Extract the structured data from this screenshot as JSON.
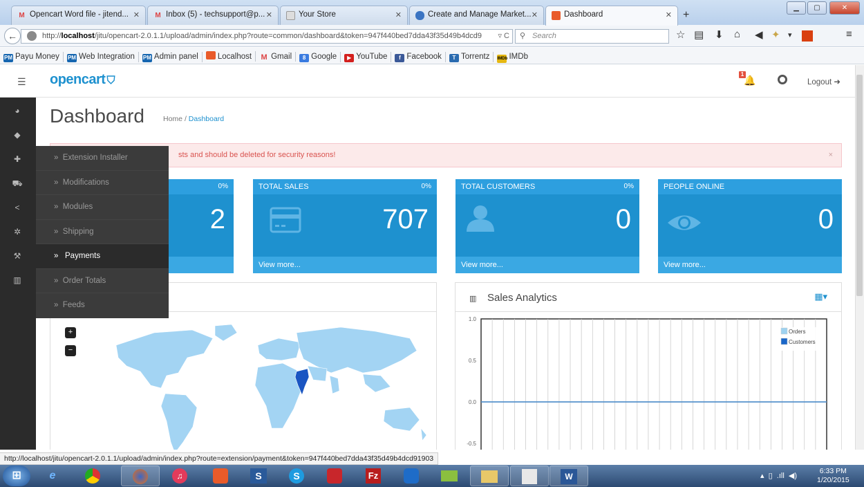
{
  "browser": {
    "tabs": [
      {
        "label": "Opencart Word file - jitend...",
        "icon": "gmail-icon",
        "icon_glyph": "M",
        "active": false
      },
      {
        "label": "Inbox (5) - techsupport@p...",
        "icon": "gmail-icon",
        "icon_glyph": "M",
        "active": false
      },
      {
        "label": "Your Store",
        "icon": "page-icon",
        "icon_glyph": "",
        "active": false
      },
      {
        "label": "Create and Manage Market...",
        "icon": "joomla-icon",
        "icon_glyph": "",
        "active": false
      },
      {
        "label": "Dashboard",
        "icon": "opencart-icon",
        "icon_glyph": "",
        "active": true
      }
    ],
    "new_tab": "+",
    "url_prefix": "http://",
    "url_host": "localhost",
    "url_path": "/jitu/opencart-2.0.1.1/upload/admin/index.php?route=common/dashboard&token=947f440bed7dda43f35d49b4dcd9",
    "search_placeholder": "Search",
    "bookmarks": [
      {
        "label": "Payu Money",
        "icon": "pm"
      },
      {
        "label": "Web Integration",
        "icon": "pm"
      },
      {
        "label": "Admin panel",
        "icon": "pm"
      },
      {
        "label": "Localhost",
        "icon": "opencart"
      },
      {
        "label": "Gmail",
        "icon": "gmail"
      },
      {
        "label": "Google",
        "icon": "google"
      },
      {
        "label": "YouTube",
        "icon": "youtube"
      },
      {
        "label": "Facebook",
        "icon": "facebook"
      },
      {
        "label": "Torrentz",
        "icon": "torrentz"
      },
      {
        "label": "IMDb",
        "icon": "imdb"
      }
    ],
    "status_url": "http://localhost/jitu/opencart-2.0.1.1/upload/admin/index.php?route=extension/payment&token=947f440bed7dda43f35d49b4dcd91903"
  },
  "header": {
    "logo": "opencart",
    "notification_count": "1",
    "logout_label": "Logout"
  },
  "flyout_menu": [
    {
      "label": "Extension Installer",
      "prefix": "»",
      "active": false
    },
    {
      "label": "Modifications",
      "prefix": "»",
      "active": false
    },
    {
      "label": "Modules",
      "prefix": "»",
      "active": false
    },
    {
      "label": "Shipping",
      "prefix": "»",
      "active": false
    },
    {
      "label": "Payments",
      "prefix": "»",
      "active": true
    },
    {
      "label": "Order Totals",
      "prefix": "»",
      "active": false
    },
    {
      "label": "Feeds",
      "prefix": "»",
      "active": false
    }
  ],
  "page": {
    "title": "Dashboard",
    "breadcrumb_home": "Home",
    "breadcrumb_sep": "/",
    "breadcrumb_current": "Dashboard"
  },
  "alert": {
    "text": "sts and should be deleted for security reasons!",
    "close": "×"
  },
  "tiles": [
    {
      "title": "",
      "percent": "0%",
      "value": "2",
      "link": "",
      "icon": ""
    },
    {
      "title": "TOTAL SALES",
      "percent": "0%",
      "value": "707",
      "link": "View more...",
      "icon": "credit-card-icon"
    },
    {
      "title": "TOTAL CUSTOMERS",
      "percent": "0%",
      "value": "0",
      "link": "View more...",
      "icon": "user-icon"
    },
    {
      "title": "PEOPLE ONLINE",
      "percent": "",
      "value": "0",
      "link": "View more...",
      "icon": "eye-icon"
    }
  ],
  "map": {
    "zoom_in": "+",
    "zoom_out": "−",
    "colors": {
      "land": "#a3d4f3",
      "highlight": "#1a55c2"
    }
  },
  "sales_analytics": {
    "title": "Sales Analytics"
  },
  "chart_data": {
    "type": "line",
    "title": "",
    "xlabel": "",
    "ylabel": "",
    "yticks": [
      "1.0",
      "0.5",
      "0.0",
      "-0.5"
    ],
    "ylim": [
      -0.75,
      1.0
    ],
    "grid": true,
    "legend_position": "top-right",
    "series": [
      {
        "name": "Orders",
        "color": "#9ed2f0",
        "values": [
          0,
          0,
          0,
          0,
          0,
          0,
          0,
          0,
          0,
          0,
          0,
          0,
          0,
          0,
          0,
          0,
          0,
          0,
          0,
          0,
          0,
          0,
          0,
          0,
          0,
          0,
          0,
          0,
          0,
          0,
          0
        ]
      },
      {
        "name": "Customers",
        "color": "#1a66c8",
        "values": [
          0,
          0,
          0,
          0,
          0,
          0,
          0,
          0,
          0,
          0,
          0,
          0,
          0,
          0,
          0,
          0,
          0,
          0,
          0,
          0,
          0,
          0,
          0,
          0,
          0,
          0,
          0,
          0,
          0,
          0,
          0
        ]
      }
    ]
  },
  "taskbar": {
    "time": "6:33 PM",
    "date": "1/20/2015"
  },
  "colors": {
    "accent": "#1e91cf",
    "tile_header": "#2d9fdf",
    "sidebar": "#2b2b2b",
    "alert_bg": "#fceaea",
    "alert_text": "#d9534f"
  }
}
